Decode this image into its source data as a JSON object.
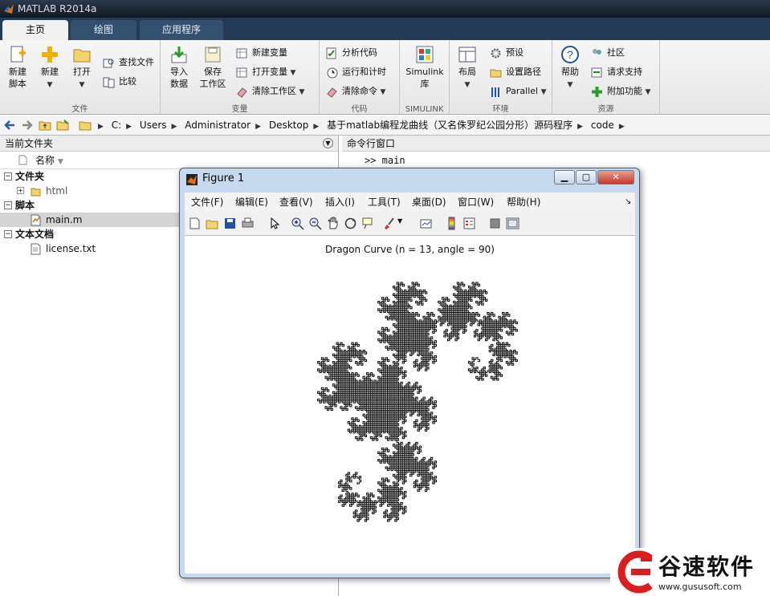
{
  "app": {
    "title": "MATLAB R2014a"
  },
  "tabs": [
    {
      "label": "主页"
    },
    {
      "label": "绘图"
    },
    {
      "label": "应用程序"
    }
  ],
  "ribbon": {
    "file": {
      "label": "文件",
      "new_script": "新建\n脚本",
      "new": "新建",
      "open": "打开",
      "find_files": "查找文件",
      "compare": "比较"
    },
    "variable": {
      "label": "变量",
      "import": "导入\n数据",
      "save_ws": "保存\n工作区",
      "new_var": "新建变量",
      "open_var": "打开变量",
      "clear_ws": "清除工作区"
    },
    "code": {
      "label": "代码",
      "analyze": "分析代码",
      "run_time": "运行和计时",
      "clear_cmd": "清除命令"
    },
    "simulink": {
      "label": "SIMULINK",
      "lib": "Simulink\n库"
    },
    "env": {
      "label": "环境",
      "layout": "布局",
      "prefs": "预设",
      "set_path": "设置路径",
      "parallel": "Parallel"
    },
    "resources": {
      "label": "资源",
      "help": "帮助",
      "community": "社区",
      "support": "请求支持",
      "addons": "附加功能"
    }
  },
  "address": {
    "segments": [
      "C:",
      "Users",
      "Administrator",
      "Desktop",
      "基于matlab编程龙曲线（又名侏罗纪公园分形）源码程序",
      "code"
    ]
  },
  "files_panel": {
    "title": "当前文件夹",
    "col_name": "名称",
    "groups": [
      {
        "name": "文件夹",
        "items": [
          "html"
        ]
      },
      {
        "name": "脚本",
        "items": [
          "main.m"
        ]
      },
      {
        "name": "文本文档",
        "items": [
          "license.txt"
        ]
      }
    ]
  },
  "command": {
    "title": "命令行窗口",
    "prompt": ">> main"
  },
  "figure": {
    "title": "Figure 1",
    "menu": [
      "文件(F)",
      "编辑(E)",
      "查看(V)",
      "插入(I)",
      "工具(T)",
      "桌面(D)",
      "窗口(W)",
      "帮助(H)"
    ],
    "plot_title": "Dragon Curve (n = 13, angle = 90)"
  },
  "chart_data": {
    "type": "line",
    "title": "Dragon Curve (n = 13, angle = 90)",
    "iterations": 13,
    "angle": 90,
    "axes_visible": false,
    "color": "#000000"
  },
  "watermark": {
    "text": "谷速软件",
    "url": "www.gususoft.com"
  }
}
